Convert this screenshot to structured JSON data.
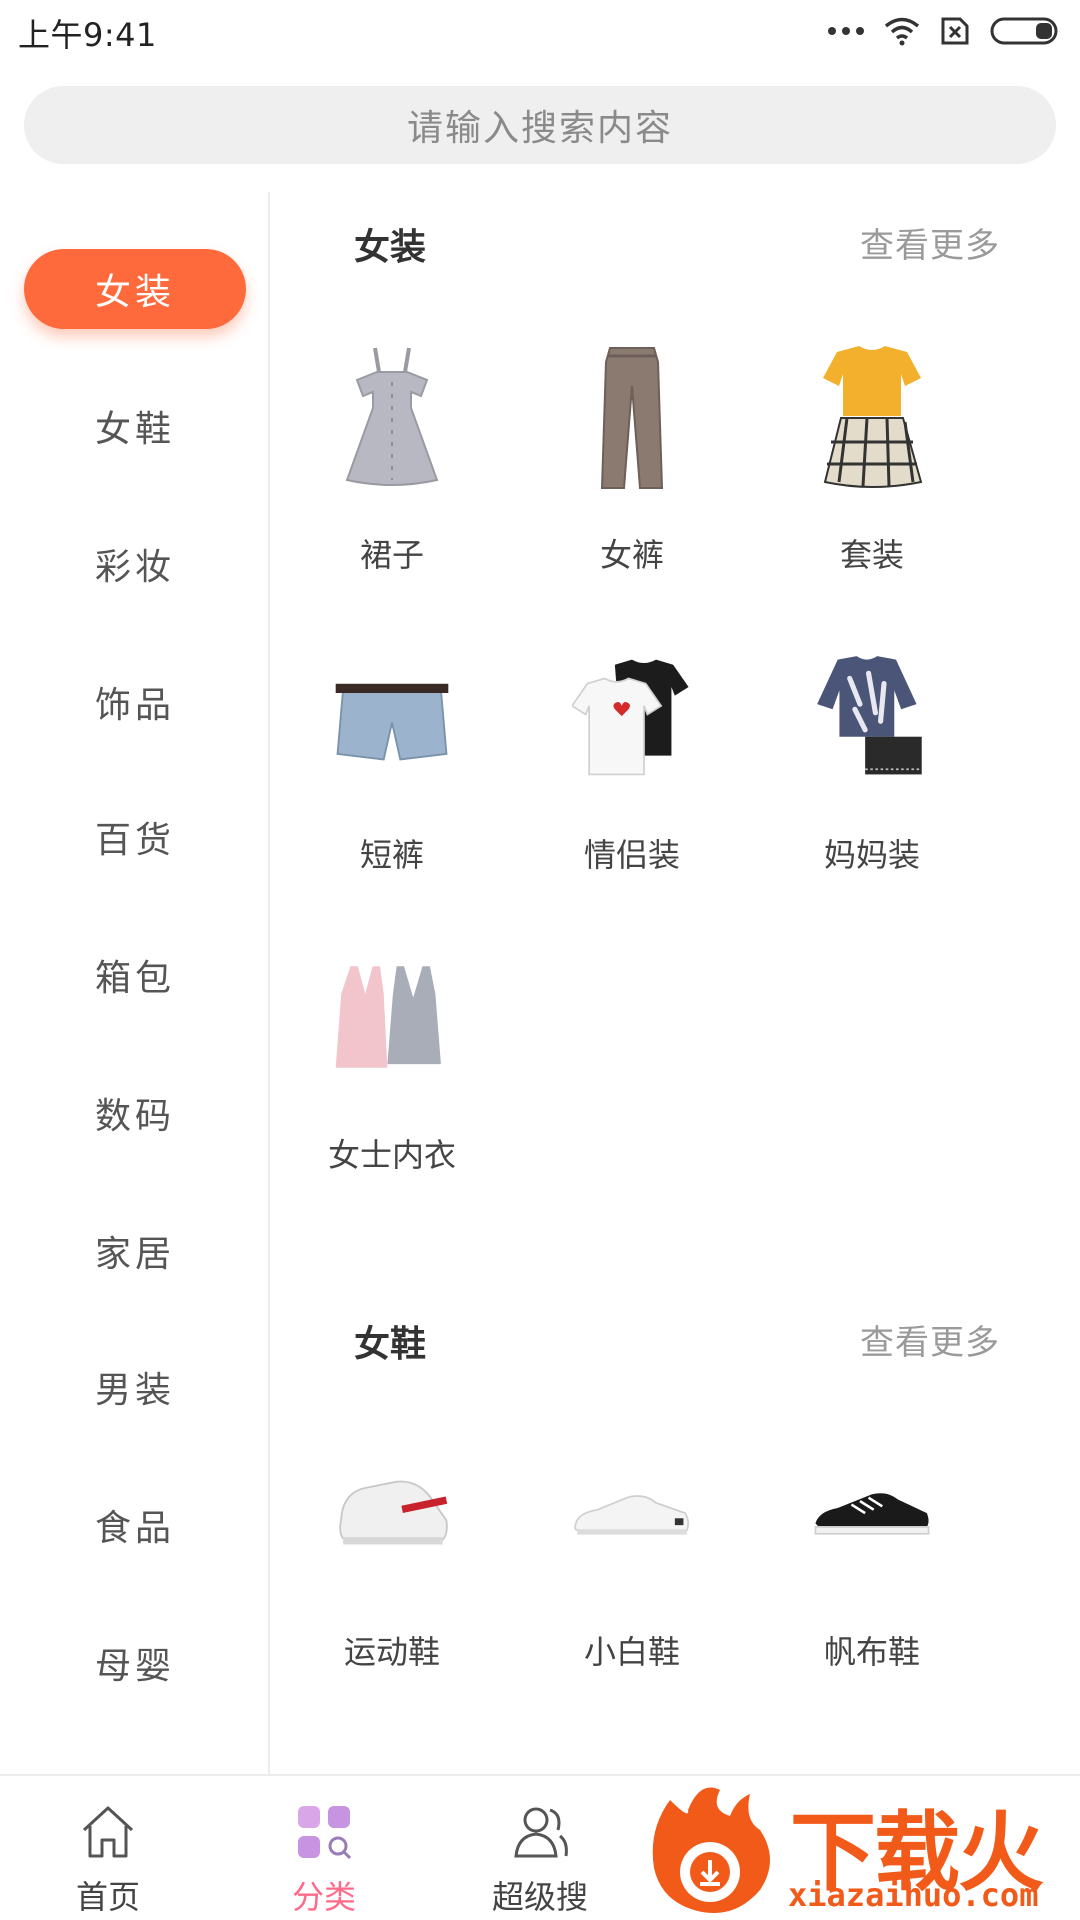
{
  "status_bar": {
    "time": "上午9:41"
  },
  "search": {
    "placeholder": "请输入搜索内容"
  },
  "sidebar": {
    "items": [
      {
        "label": "女装",
        "active": true
      },
      {
        "label": "女鞋"
      },
      {
        "label": "彩妆"
      },
      {
        "label": "饰品"
      },
      {
        "label": "百货"
      },
      {
        "label": "箱包"
      },
      {
        "label": "数码"
      },
      {
        "label": "家居"
      },
      {
        "label": "男装"
      },
      {
        "label": "食品"
      },
      {
        "label": "母婴"
      }
    ]
  },
  "sections": [
    {
      "title": "女装",
      "more": "查看更多",
      "items": [
        {
          "label": "裙子",
          "icon": "dress-icon"
        },
        {
          "label": "女裤",
          "icon": "pants-icon"
        },
        {
          "label": "套装",
          "icon": "outfit-set-icon"
        },
        {
          "label": "短裤",
          "icon": "shorts-icon"
        },
        {
          "label": "情侣装",
          "icon": "couple-tshirt-icon"
        },
        {
          "label": "妈妈装",
          "icon": "mom-outfit-icon"
        },
        {
          "label": "女士内衣",
          "icon": "camisole-icon"
        }
      ]
    },
    {
      "title": "女鞋",
      "more": "查看更多",
      "items": [
        {
          "label": "运动鞋",
          "icon": "sneaker-icon"
        },
        {
          "label": "小白鞋",
          "icon": "white-shoe-icon"
        },
        {
          "label": "帆布鞋",
          "icon": "canvas-shoe-icon"
        }
      ]
    }
  ],
  "bottom_nav": {
    "items": [
      {
        "label": "首页",
        "icon": "home-icon"
      },
      {
        "label": "分类",
        "icon": "category-icon",
        "active": true
      },
      {
        "label": "超级搜",
        "icon": "users-icon"
      }
    ]
  },
  "watermark": {
    "text": "下载火",
    "url": "xiazaihuo.com"
  },
  "colors": {
    "accent": "#ff6a3d",
    "active_nav": "#ff6a8a",
    "watermark": "#f25a1a"
  }
}
